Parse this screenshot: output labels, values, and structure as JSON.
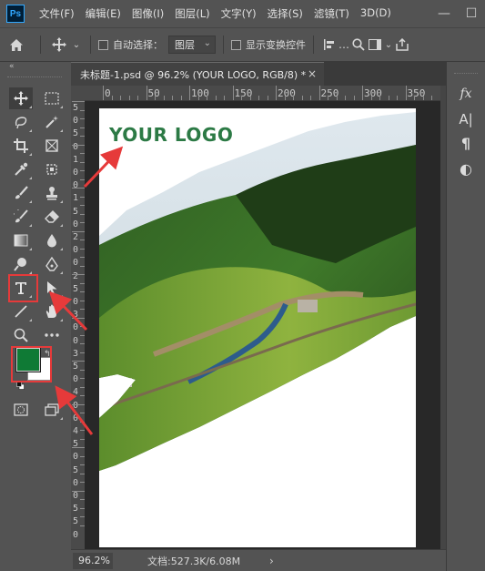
{
  "app": {
    "logo_text": "Ps",
    "menu": [
      "文件(F)",
      "编辑(E)",
      "图像(I)",
      "图层(L)",
      "文字(Y)",
      "选择(S)",
      "滤镜(T)",
      "3D(D)"
    ],
    "window_controls": {
      "minimize": "—",
      "maximize": "☐"
    }
  },
  "options": {
    "auto_select_label": "自动选择：",
    "layer_select_value": "图层",
    "show_transform_label": "显示变换控件"
  },
  "document": {
    "tab_title": "未标题-1.psd @ 96.2% (YOUR LOGO, RGB/8) *",
    "close_glyph": "×",
    "logo_text": "YOUR LOGO"
  },
  "ruler": {
    "h_labels": [
      "0",
      "50",
      "100",
      "150",
      "200",
      "250",
      "300",
      "350"
    ],
    "v_labels": [
      "5",
      "0",
      "5",
      "0",
      "1",
      "0",
      "0",
      "1",
      "5",
      "0",
      "2",
      "0",
      "0",
      "2",
      "5",
      "0",
      "3",
      "0",
      "0",
      "3",
      "5",
      "0",
      "4",
      "0",
      "0",
      "4",
      "5",
      "0",
      "5",
      "0",
      "0",
      "5",
      "5",
      "0"
    ]
  },
  "status": {
    "zoom": "96.2%",
    "doc_info": "文档:527.3K/6.08M",
    "arrow": "›"
  },
  "colors": {
    "foreground": "#0f7a35",
    "background": "#ffffff",
    "logo_green": "#2c7a45",
    "annotation_red": "#e63a3a"
  },
  "right_panel_icons": [
    "fx-icon",
    "character-icon",
    "paragraph-icon",
    "adjustments-icon"
  ],
  "right_panel_labels": {
    "fx": "fx",
    "character": "A|",
    "paragraph": "¶",
    "adjust": "◐"
  }
}
